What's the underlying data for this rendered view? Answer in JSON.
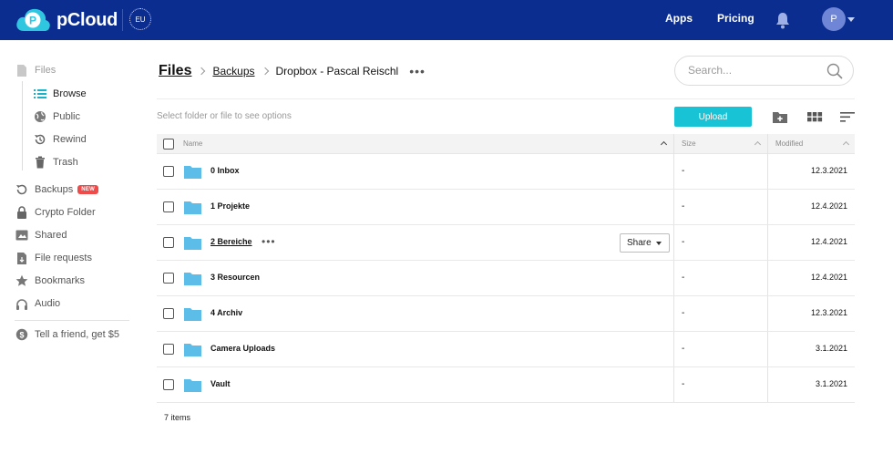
{
  "header": {
    "brand": "pCloud",
    "region": "EU",
    "nav": [
      "Apps",
      "Pricing"
    ],
    "avatar_initial": "P",
    "colors": {
      "bar": "#0a2d8f",
      "accent": "#17c3d4"
    }
  },
  "sidebar": {
    "items": [
      {
        "label": "Files",
        "icon": "file-icon"
      },
      {
        "label": "Browse",
        "icon": "list-icon"
      },
      {
        "label": "Public",
        "icon": "globe-icon"
      },
      {
        "label": "Rewind",
        "icon": "history-icon"
      },
      {
        "label": "Trash",
        "icon": "trash-icon"
      },
      {
        "label": "Backups",
        "icon": "backup-icon",
        "badge": "NEW"
      },
      {
        "label": "Crypto Folder",
        "icon": "lock-icon"
      },
      {
        "label": "Shared",
        "icon": "shared-icon"
      },
      {
        "label": "File requests",
        "icon": "file-request-icon"
      },
      {
        "label": "Bookmarks",
        "icon": "star-icon"
      },
      {
        "label": "Audio",
        "icon": "headphones-icon"
      },
      {
        "label": "Tell a friend, get $5",
        "icon": "dollar-icon"
      }
    ]
  },
  "breadcrumb": {
    "root": "Files",
    "parent": "Backups",
    "current": "Dropbox - Pascal Reischl"
  },
  "search": {
    "placeholder": "Search..."
  },
  "toolbar": {
    "hint": "Select folder or file to see options",
    "upload_label": "Upload"
  },
  "table": {
    "columns": [
      "Name",
      "Size",
      "Modified"
    ],
    "rows": [
      {
        "name": "0 Inbox",
        "size": "-",
        "modified": "12.3.2021"
      },
      {
        "name": "1 Projekte",
        "size": "-",
        "modified": "12.4.2021"
      },
      {
        "name": "2 Bereiche",
        "size": "-",
        "modified": "12.4.2021",
        "share_label": "Share"
      },
      {
        "name": "3 Resourcen",
        "size": "-",
        "modified": "12.4.2021"
      },
      {
        "name": "4 Archiv",
        "size": "-",
        "modified": "12.3.2021"
      },
      {
        "name": "Camera Uploads",
        "size": "-",
        "modified": "3.1.2021"
      },
      {
        "name": "Vault",
        "size": "-",
        "modified": "3.1.2021"
      }
    ],
    "footer": "7 items"
  }
}
